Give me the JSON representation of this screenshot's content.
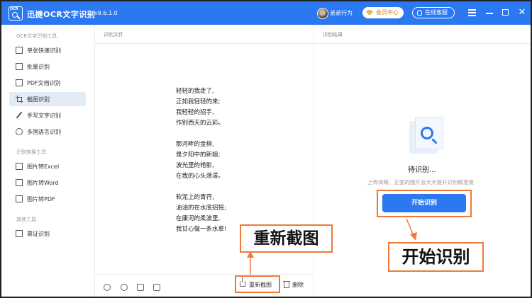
{
  "app": {
    "title": "迅捷OCR文字识别",
    "version": "v8.6.1.0",
    "logo_text": "OCR"
  },
  "header": {
    "username": "弟弟行为",
    "vip_label": "会员中心",
    "service_label": "在线客服"
  },
  "sidebar": {
    "sections": [
      {
        "title": "OCR文字识别工具",
        "items": [
          {
            "label": "单张快速识别",
            "icon": "single-scan-icon"
          },
          {
            "label": "批量识别",
            "icon": "batch-icon"
          },
          {
            "label": "PDF文档识别",
            "icon": "pdf-doc-icon"
          },
          {
            "label": "截图识别",
            "icon": "crop-icon",
            "active": true
          },
          {
            "label": "手写文字识别",
            "icon": "pen-icon"
          },
          {
            "label": "多国语言识别",
            "icon": "globe-icon"
          }
        ]
      },
      {
        "title": "识别转换工具",
        "items": [
          {
            "label": "图片转Excel",
            "icon": "excel-icon"
          },
          {
            "label": "图片转Word",
            "icon": "word-icon"
          },
          {
            "label": "图片转PDF",
            "icon": "pdf-icon"
          }
        ]
      },
      {
        "title": "其他工具",
        "items": [
          {
            "label": "票证识别",
            "icon": "ticket-icon"
          }
        ]
      }
    ]
  },
  "middle": {
    "title": "识别文件",
    "poem": [
      "轻轻的我走了,",
      "正如我轻轻的来;",
      "我轻轻的招手,",
      "作别西天的云彩。",
      "",
      "那河畔的金柳,",
      "是夕阳中的新娘;",
      "波光里的艳影,",
      "在我的心头荡漾。",
      "",
      "软泥上的青荇,",
      "油油的在水底招摇;",
      "在康河的柔波里,",
      "我甘心做一条水草!"
    ],
    "recapture_label": "重新截图",
    "delete_label": "删除"
  },
  "result": {
    "title": "识别结果",
    "waiting": "待识别...",
    "hint": "上传清晰、正面的图片会大大提升识别精准度",
    "start_label": "开始识别"
  },
  "annotations": {
    "recapture_callout": "重新截图",
    "start_callout": "开始识别"
  },
  "colors": {
    "brand": "#2b78f0",
    "highlight": "#ee7a3a",
    "active_bg": "#e3ebf7"
  }
}
